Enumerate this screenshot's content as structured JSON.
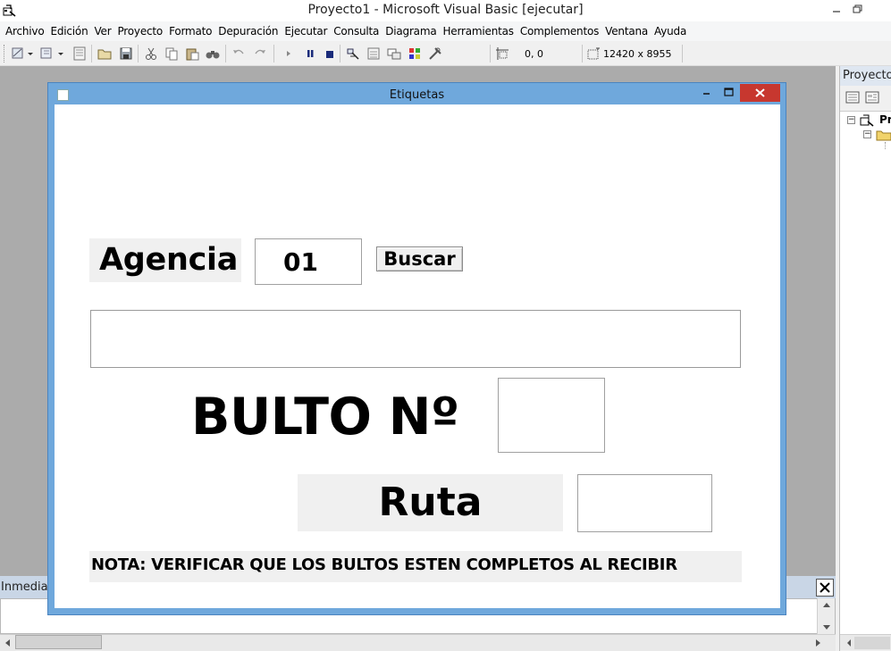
{
  "window": {
    "title": "Proyecto1 - Microsoft Visual Basic [ejecutar]"
  },
  "menu": {
    "items": [
      "Archivo",
      "Edición",
      "Ver",
      "Proyecto",
      "Formato",
      "Depuración",
      "Ejecutar",
      "Consulta",
      "Diagrama",
      "Herramientas",
      "Complementos",
      "Ventana",
      "Ayuda"
    ]
  },
  "toolbar": {
    "position_readout": "0, 0",
    "size_readout": "12420 x 8955"
  },
  "project_panel": {
    "title": "Proyecto",
    "root_label": "Pr"
  },
  "immediate": {
    "title": "Inmedia"
  },
  "form": {
    "title": "Etiquetas",
    "agencia_label": "Agencia",
    "agencia_value": "01",
    "buscar_label": "Buscar",
    "nombre_value": "",
    "bulto_label": "BULTO Nº",
    "bulto_value": "",
    "ruta_label": "Ruta",
    "ruta_value": "",
    "nota_label": "NOTA: VERIFICAR QUE LOS BULTOS ESTEN COMPLETOS AL RECIBIR"
  },
  "colors": {
    "form_frame": "#6fa8dc",
    "close_button": "#c7372f",
    "workspace": "#ababab"
  },
  "icons": [
    "vb-app-icon",
    "minimize-icon",
    "restore-icon",
    "close-icon",
    "play-icon",
    "pause-icon",
    "stop-icon"
  ]
}
